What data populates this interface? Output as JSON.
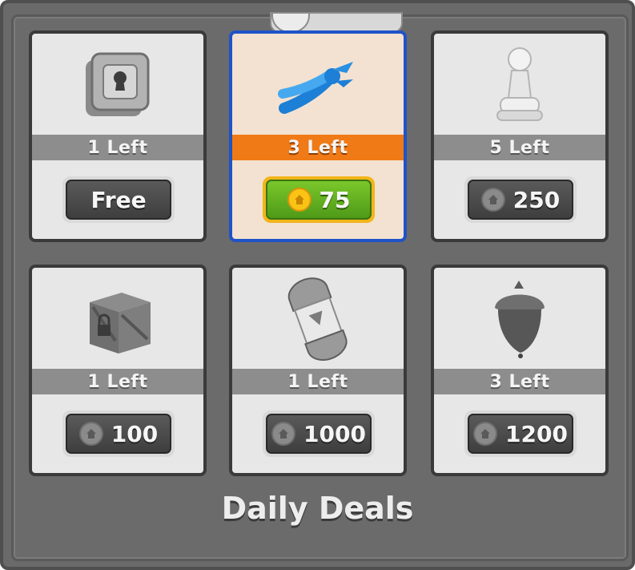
{
  "screen": {
    "title": "Daily Deals"
  },
  "deals": [
    {
      "item": "safe",
      "left_text": "1 Left",
      "price": "Free",
      "currency_icon": "",
      "selected": false
    },
    {
      "item": "pliers",
      "left_text": "3 Left",
      "price": "75",
      "currency_icon": "house-coin-icon",
      "selected": true
    },
    {
      "item": "pawn",
      "left_text": "5 Left",
      "price": "250",
      "currency_icon": "house-coin-icon",
      "selected": false
    },
    {
      "item": "crate",
      "left_text": "1 Left",
      "price": "100",
      "currency_icon": "house-coin-icon",
      "selected": false
    },
    {
      "item": "capsule",
      "left_text": "1 Left",
      "price": "1000",
      "currency_icon": "house-coin-icon",
      "selected": false
    },
    {
      "item": "acorn",
      "left_text": "3 Left",
      "price": "1200",
      "currency_icon": "house-coin-icon",
      "selected": false
    }
  ],
  "colors": {
    "selected_border": "#1f53c7",
    "selected_bar": "#ef7a16",
    "selected_button": "#6bbb24",
    "coin": "#f9c415"
  }
}
